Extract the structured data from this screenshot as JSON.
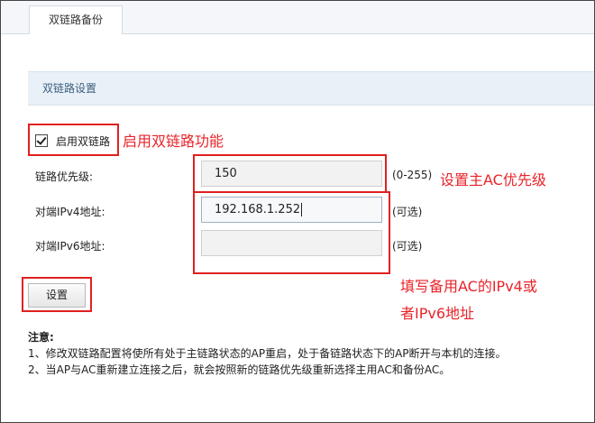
{
  "tab": {
    "label": "双链路备份"
  },
  "section": {
    "title": "双链路设置"
  },
  "enable": {
    "label": "启用双链路",
    "checked": true
  },
  "fields": {
    "priority": {
      "label": "链路优先级:",
      "value": "150",
      "hint": "(0-255)"
    },
    "ipv4": {
      "label": "对端IPv4地址:",
      "value": "192.168.1.252",
      "hint": "(可选)"
    },
    "ipv6": {
      "label": "对端IPv6地址:",
      "value": "",
      "hint": "(可选)"
    }
  },
  "save_button": {
    "label": "设置"
  },
  "notes": {
    "title": "注意:",
    "line1": "1、修改双链路配置将使所有处于主链路状态的AP重启，处于备链路状态下的AP断开与本机的连接。",
    "line2": "2、当AP与AC重新建立连接之后，就会按照新的链路优先级重新选择主用AC和备份AC。"
  },
  "annotations": {
    "enable": "启用双链路功能",
    "priority": "设置主AC优先级",
    "peer_line1": "填写备用AC的IPv4或",
    "peer_line2": "者IPv6地址"
  },
  "colors": {
    "annotation_red": "#e02020",
    "section_bg": "#e9f0f7"
  }
}
